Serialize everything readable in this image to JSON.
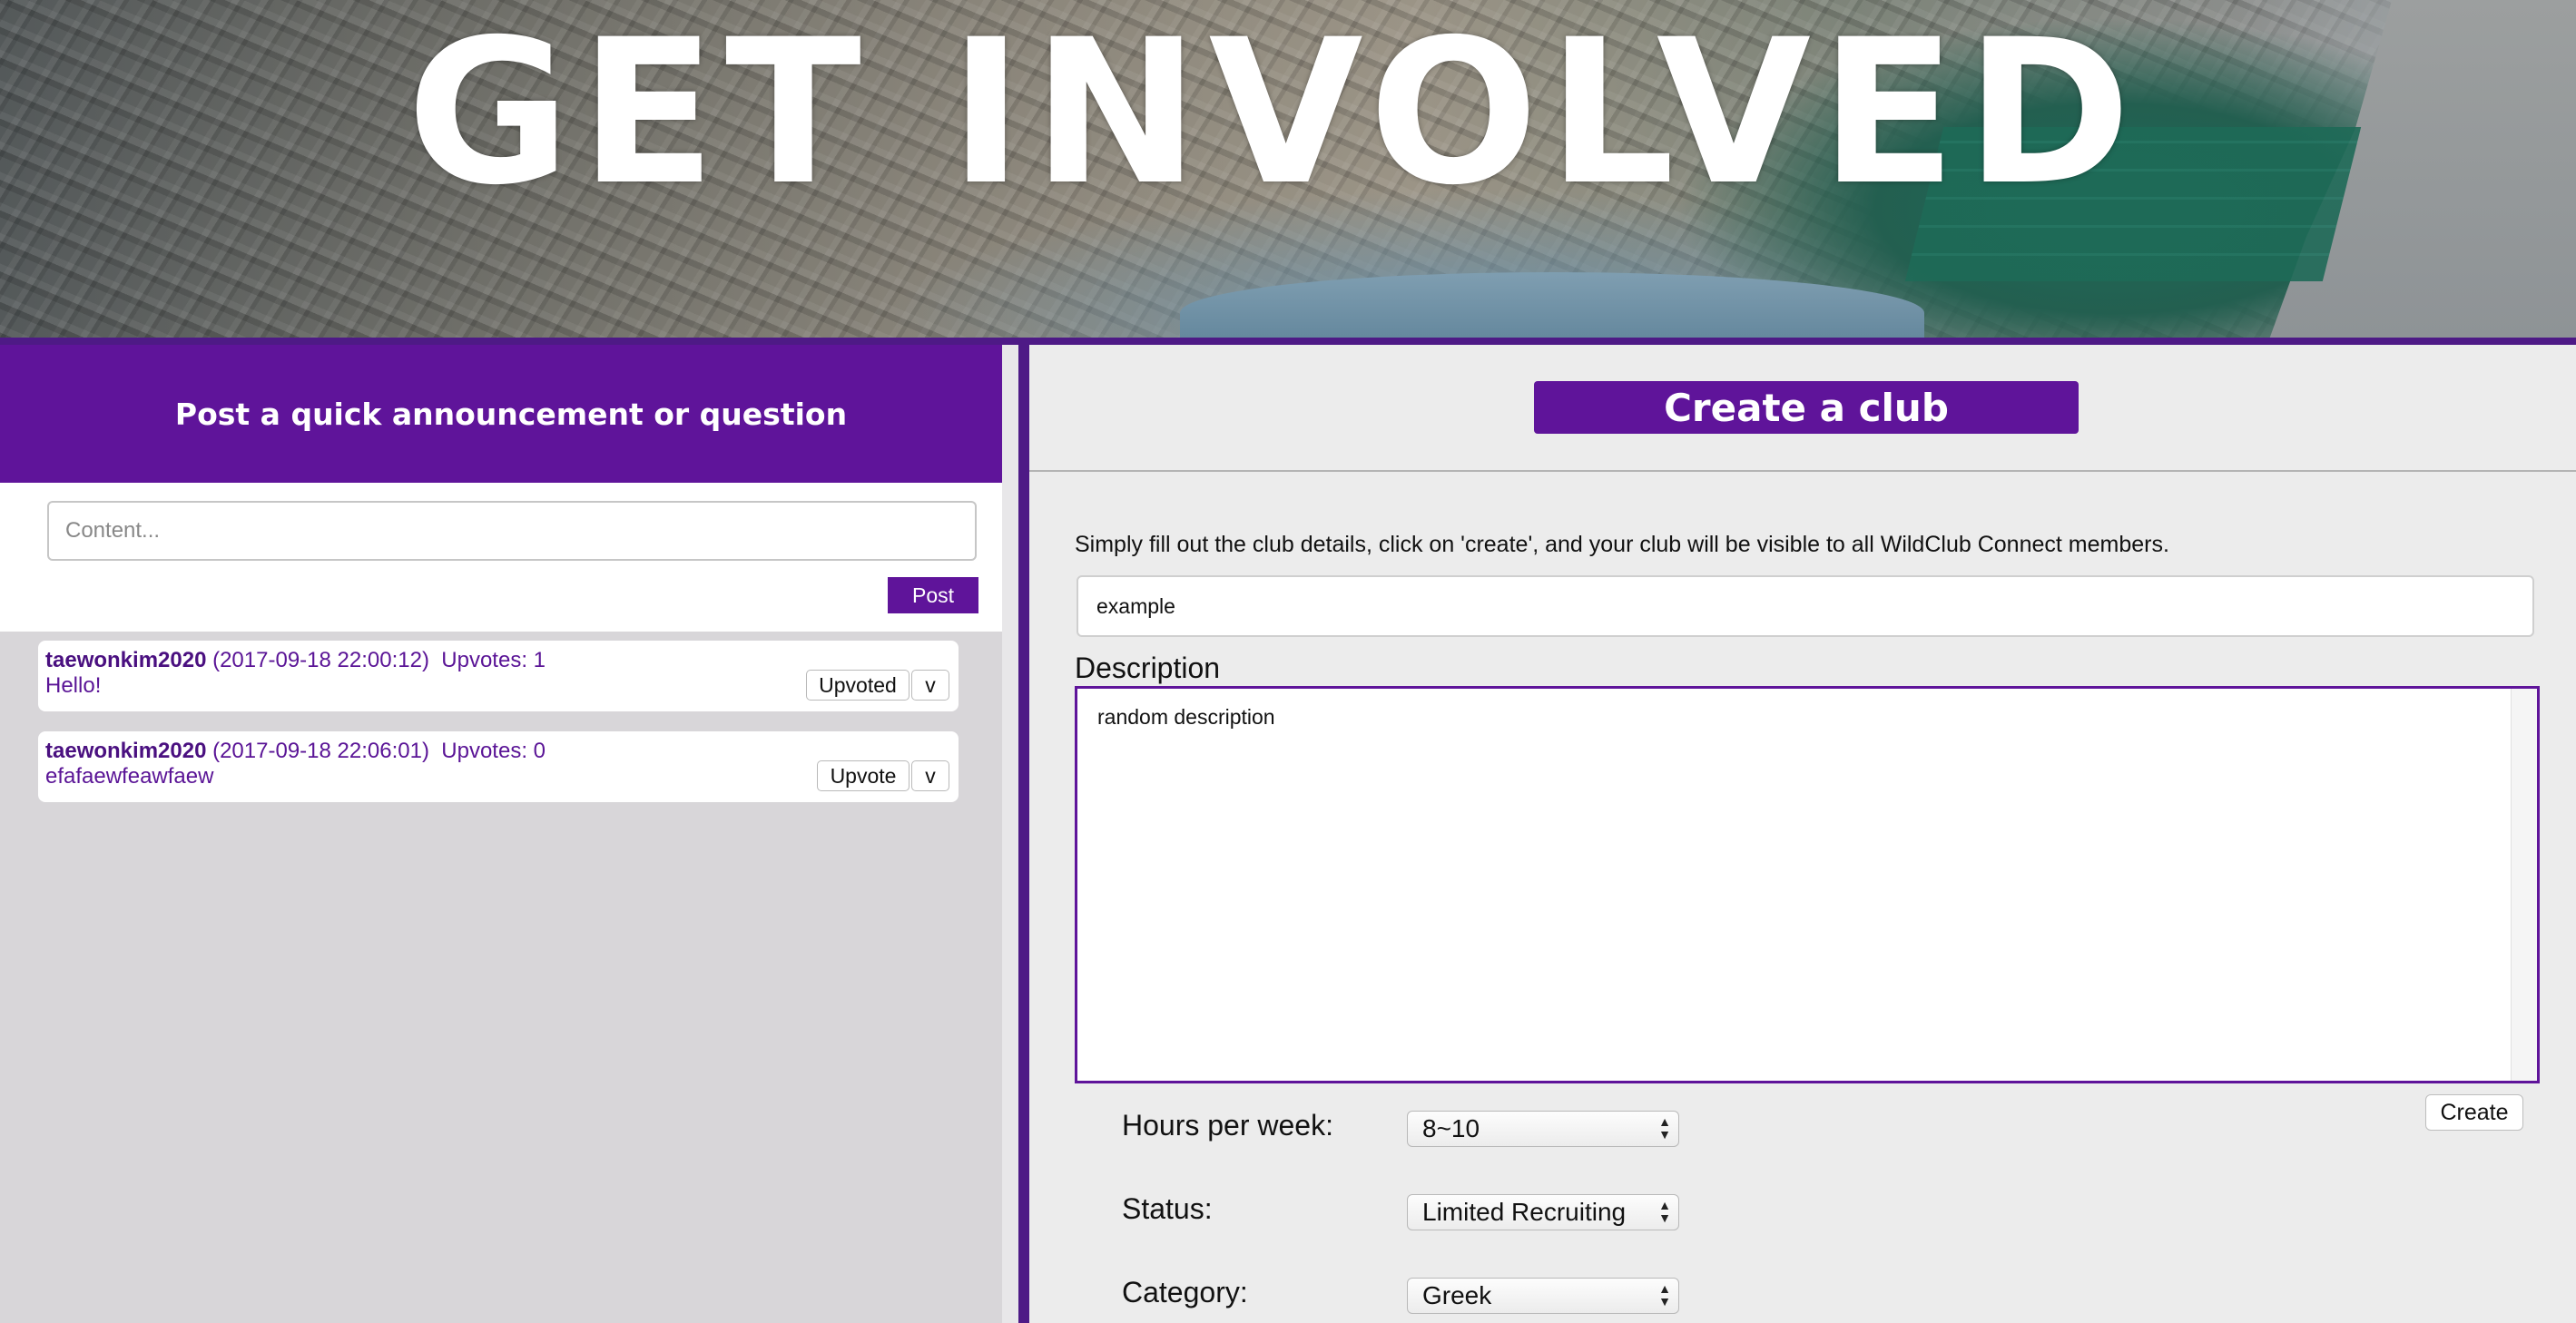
{
  "hero": {
    "title": "GET INVOLVED"
  },
  "announcements": {
    "header": "Post a quick announcement or question",
    "input_placeholder": "Content...",
    "post_label": "Post",
    "posts": [
      {
        "author": "taewonkim2020",
        "timestamp": "(2017-09-18 22:00:12)",
        "upvotes": "Upvotes: 1",
        "body": "Hello!",
        "upvote_label": "Upvoted",
        "more_label": "v"
      },
      {
        "author": "taewonkim2020",
        "timestamp": "(2017-09-18 22:06:01)",
        "upvotes": "Upvotes: 0",
        "body": "efafaewfeawfaew",
        "upvote_label": "Upvote",
        "more_label": "v"
      }
    ]
  },
  "create_club": {
    "title": "Create a club",
    "intro": "Simply fill out the club details, click on 'create', and your club will be visible to all WildClub Connect members.",
    "name_value": "example",
    "description_label": "Description",
    "description_value": "random description",
    "create_label": "Create",
    "fields": {
      "hours_label": "Hours per week:",
      "hours_value": "8~10",
      "status_label": "Status:",
      "status_value": "Limited Recruiting",
      "category_label": "Category:",
      "category_value": "Greek"
    }
  },
  "colors": {
    "accent": "#5f149a",
    "divider": "#4e1a86",
    "feed_bg": "#d8d6d9"
  }
}
